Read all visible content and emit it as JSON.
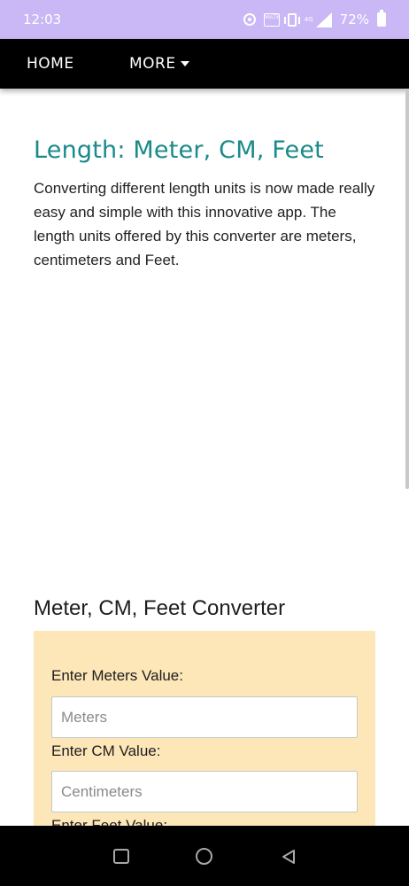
{
  "status_bar": {
    "time": "12:03",
    "volte_label": "VoLTE",
    "network_label": "4G",
    "battery_percent": "72%",
    "icons": [
      "hotspot-icon",
      "volte-icon",
      "vibrate-icon",
      "signal-icon",
      "battery-icon"
    ]
  },
  "nav": {
    "home_label": "HOME",
    "more_label": "MORE",
    "more_icon": "caret-down-icon"
  },
  "content": {
    "title": "Length: Meter, CM, Feet",
    "intro": "Converting different length units is now made really easy and simple with this innovative app. The length units offered by this converter are meters, centimeters and Feet."
  },
  "converter": {
    "title": "Meter, CM, Feet Converter",
    "meters_label": "Enter Meters Value:",
    "meters_placeholder": "Meters",
    "cm_label": "Enter CM Value:",
    "cm_placeholder": "Centimeters",
    "feet_label": "Enter Feet Value:"
  },
  "colors": {
    "status_bar_bg": "#c9b8f5",
    "nav_bg": "#000000",
    "title_color": "#1a8a8a",
    "converter_bg": "#fde6b8"
  },
  "system_nav": {
    "icons": [
      "recents-icon",
      "home-icon",
      "back-icon"
    ]
  }
}
